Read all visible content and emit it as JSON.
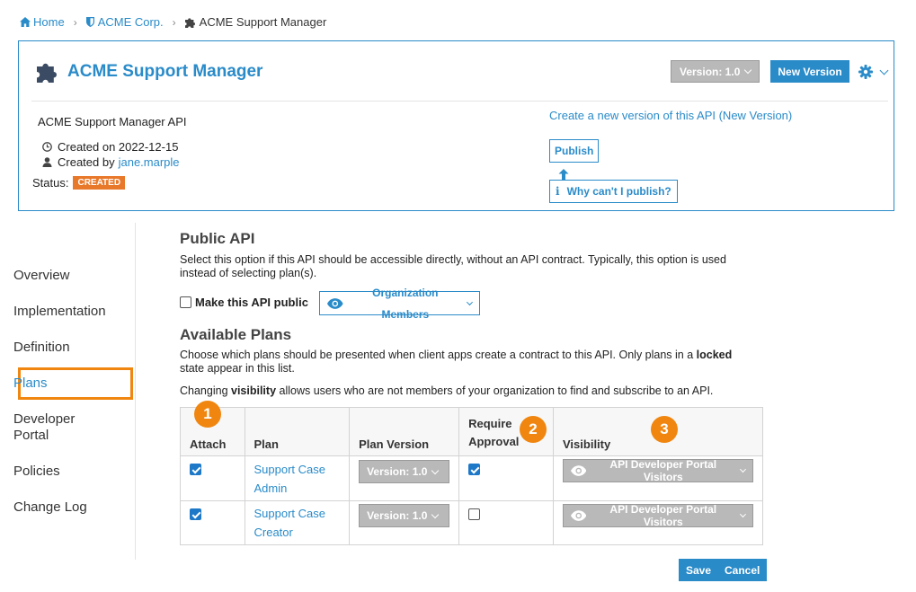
{
  "breadcrumb": {
    "home": "Home",
    "org": "ACME Corp.",
    "current": "ACME Support Manager"
  },
  "header": {
    "title": "ACME Support Manager",
    "version_label": "Version: 1.0",
    "new_version_label": "New Version",
    "description": "ACME Support Manager API",
    "created_on": "Created on 2022-12-15",
    "created_by_prefix": "Created by",
    "created_by_user": "jane.marple",
    "status_label": "Status:",
    "status_badge": "CREATED",
    "create_version_link": "Create a new version of this API (New Version)",
    "publish_label": "Publish",
    "why_label": "Why can't I publish?"
  },
  "sidebar": {
    "items": [
      {
        "label": "Overview"
      },
      {
        "label": "Implementation"
      },
      {
        "label": "Definition"
      },
      {
        "label": "Plans"
      },
      {
        "label": "Developer Portal",
        "line1": "Developer",
        "line2": "Portal"
      },
      {
        "label": "Policies"
      },
      {
        "label": "Change Log"
      }
    ],
    "active": "Plans"
  },
  "public_api": {
    "heading": "Public API",
    "description": "Select this option if this API should be accessible directly, without an API contract. Typically, this option is used instead of selecting plan(s).",
    "line1": "Select this option if this API should be accessible directly, without an API contract. Typically, this option is used",
    "line2": "instead of selecting plan(s).",
    "checkbox_label": "Make this API public",
    "checked": false,
    "visibility_label": "Organization Members"
  },
  "plans": {
    "heading": "Available Plans",
    "desc_line1_a": "Choose which plans should be presented when client apps create a contract to this API. Only plans in a ",
    "desc_line1_b": "locked",
    "desc_line2": "state appear in this list.",
    "vis_a": "Changing ",
    "vis_b": "visibility",
    "vis_c": " allows users who are not members of your organization to find and subscribe to an API.",
    "columns": [
      "Attach",
      "Plan",
      "Plan Version",
      "Require Approval",
      "Visibility"
    ],
    "require_line1": "Require",
    "require_line2": "Approval",
    "rows": [
      {
        "attach": true,
        "plan_line1": "Support Case",
        "plan_line2": "Admin",
        "version": "Version: 1.0",
        "require_approval": true,
        "visibility": "API Developer Portal Visitors"
      },
      {
        "attach": true,
        "plan_line1": "Support Case",
        "plan_line2": "Creator",
        "version": "Version: 1.0",
        "require_approval": false,
        "visibility": "API Developer Portal Visitors"
      }
    ],
    "markers": [
      "1",
      "2",
      "3"
    ]
  },
  "actions": {
    "save": "Save",
    "cancel": "Cancel"
  },
  "colors": {
    "accent": "#2a8bc9",
    "highlight": "#f0860f",
    "status": "#e8782a"
  }
}
